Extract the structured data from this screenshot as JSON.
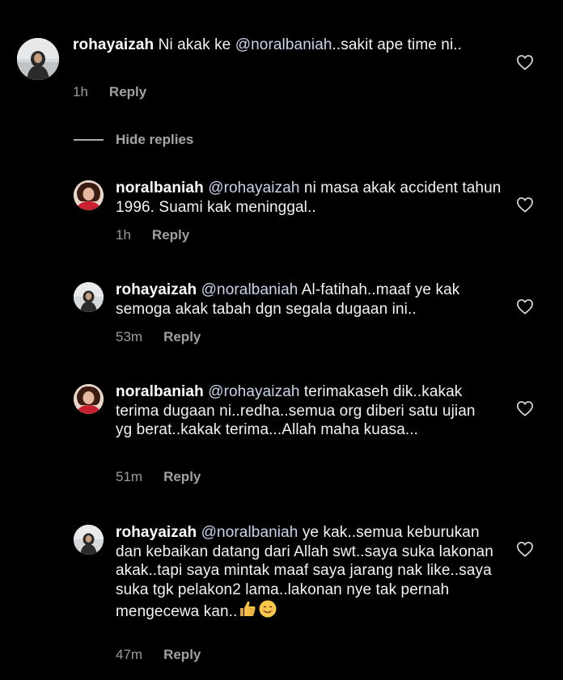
{
  "comments": [
    {
      "username": "rohayaizah",
      "mention": "",
      "text": "Ni akak ke @noralbaniah..sakit ape time ni..",
      "text_pre": " Ni akak ke ",
      "text_mention": "@noralbaniah",
      "text_post": "..sakit ape time ni..",
      "time": "1h",
      "reply_label": "Reply",
      "avatar": "rohayaizah-avatar"
    },
    {
      "username": "noralbaniah",
      "text_mention": "@rohayaizah",
      "text_post": " ni masa akak accident tahun 1996. Suami kak meninggal..",
      "time": "1h",
      "reply_label": "Reply",
      "avatar": "noralbaniah-avatar"
    },
    {
      "username": "rohayaizah",
      "text_mention": "@noralbaniah",
      "text_post": " Al-fatihah..maaf ye kak semoga akak tabah dgn segala dugaan ini..",
      "time": "53m",
      "reply_label": "Reply",
      "avatar": "rohayaizah-avatar"
    },
    {
      "username": "noralbaniah",
      "text_mention": "@rohayaizah",
      "text_post": " terimakaseh dik..kakak terima dugaan ni..redha..semua org diberi satu ujian yg berat..kakak terima...Allah maha kuasa...",
      "time": "51m",
      "reply_label": "Reply",
      "avatar": "noralbaniah-avatar"
    },
    {
      "username": "rohayaizah",
      "text_mention": "@noralbaniah",
      "text_post": " ye kak..semua keburukan dan kebaikan datang dari Allah swt..saya suka lakonan akak..tapi saya mintak maaf saya jarang nak like..saya suka tgk pelakon2 lama..lakonan nye tak pernah mengecewa kan..",
      "emojis": [
        "thumbs-up-emoji",
        "smiling-face-emoji"
      ],
      "time": "47m",
      "reply_label": "Reply",
      "avatar": "rohayaizah-avatar"
    }
  ],
  "hide_replies_label": "Hide replies",
  "colors": {
    "background": "#000000",
    "text": "#f2f2f2",
    "mention": "#c9d3ea",
    "meta": "#9a9a9a"
  }
}
